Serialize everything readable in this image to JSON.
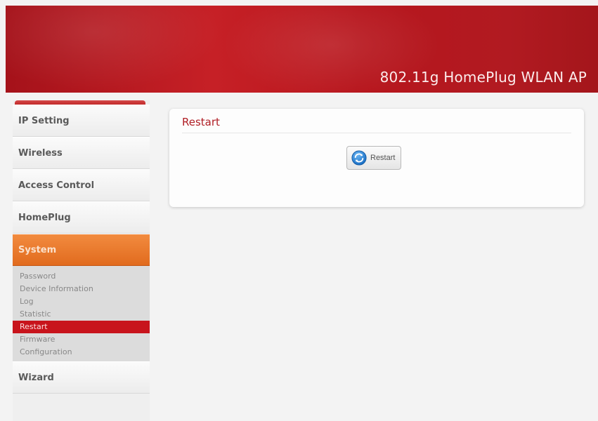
{
  "header": {
    "title": "802.11g HomePlug WLAN AP"
  },
  "sidebar": {
    "items": [
      {
        "label": "IP Setting",
        "active": false
      },
      {
        "label": "Wireless",
        "active": false
      },
      {
        "label": "Access Control",
        "active": false
      },
      {
        "label": "HomePlug",
        "active": false
      },
      {
        "label": "System",
        "active": true
      }
    ],
    "submenu": [
      {
        "label": "Password",
        "active": false
      },
      {
        "label": "Device Information",
        "active": false
      },
      {
        "label": "Log",
        "active": false
      },
      {
        "label": "Statistic",
        "active": false
      },
      {
        "label": "Restart",
        "active": true
      },
      {
        "label": "Firmware",
        "active": false
      },
      {
        "label": "Configuration",
        "active": false
      }
    ],
    "after_items": [
      {
        "label": "Wizard",
        "active": false
      }
    ]
  },
  "main": {
    "panel_title": "Restart",
    "restart_button_label": "Restart",
    "restart_icon": "refresh-icon"
  },
  "colors": {
    "header_red": "#c62026",
    "active_orange": "#e16b1e",
    "active_sub_red": "#c8141c",
    "panel_title_red": "#b01d24"
  }
}
